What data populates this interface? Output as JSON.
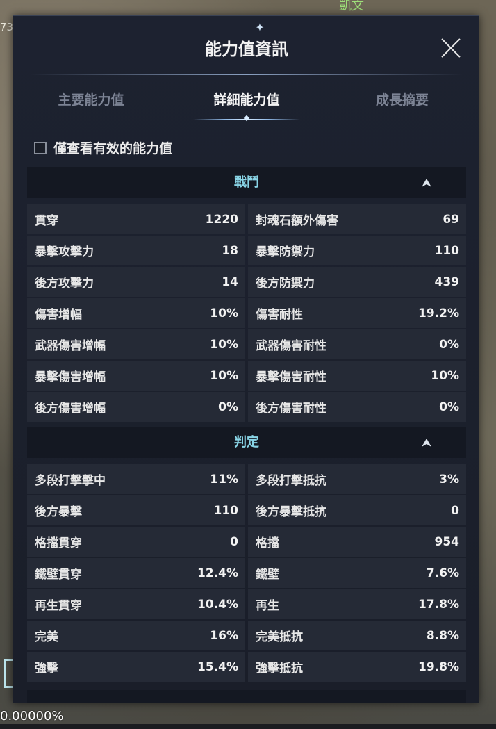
{
  "background": {
    "left_edge_text": "73",
    "top_text": "凱文",
    "bottom_text": "0.00000%"
  },
  "dialog": {
    "title": "能力值資訊",
    "close_icon": "close-icon",
    "tabs": [
      {
        "label": "主要能力值",
        "active": false
      },
      {
        "label": "詳細能力值",
        "active": true
      },
      {
        "label": "成長摘要",
        "active": false
      }
    ],
    "filter": {
      "label": "僅查看有效的能力值",
      "checked": false
    },
    "sections": [
      {
        "title": "戰鬥",
        "collapse_icon": "chevron-up-icon",
        "rows": [
          [
            {
              "label": "貫穿",
              "value": "1220"
            },
            {
              "label": "封魂石額外傷害",
              "value": "69"
            }
          ],
          [
            {
              "label": "暴擊攻擊力",
              "value": "18"
            },
            {
              "label": "暴擊防禦力",
              "value": "110"
            }
          ],
          [
            {
              "label": "後方攻擊力",
              "value": "14"
            },
            {
              "label": "後方防禦力",
              "value": "439"
            }
          ],
          [
            {
              "label": "傷害增幅",
              "value": "10%"
            },
            {
              "label": "傷害耐性",
              "value": "19.2%"
            }
          ],
          [
            {
              "label": "武器傷害增幅",
              "value": "10%"
            },
            {
              "label": "武器傷害耐性",
              "value": "0%"
            }
          ],
          [
            {
              "label": "暴擊傷害增幅",
              "value": "10%"
            },
            {
              "label": "暴擊傷害耐性",
              "value": "10%"
            }
          ],
          [
            {
              "label": "後方傷害增幅",
              "value": "0%"
            },
            {
              "label": "後方傷害耐性",
              "value": "0%"
            }
          ]
        ]
      },
      {
        "title": "判定",
        "collapse_icon": "chevron-up-icon",
        "rows": [
          [
            {
              "label": "多段打擊擊中",
              "value": "11%"
            },
            {
              "label": "多段打擊抵抗",
              "value": "3%"
            }
          ],
          [
            {
              "label": "後方暴擊",
              "value": "110"
            },
            {
              "label": "後方暴擊抵抗",
              "value": "0"
            }
          ],
          [
            {
              "label": "格擋貫穿",
              "value": "0"
            },
            {
              "label": "格擋",
              "value": "954"
            }
          ],
          [
            {
              "label": "鐵壁貫穿",
              "value": "12.4%"
            },
            {
              "label": "鐵壁",
              "value": "7.6%"
            }
          ],
          [
            {
              "label": "再生貫穿",
              "value": "10.4%"
            },
            {
              "label": "再生",
              "value": "17.8%"
            }
          ],
          [
            {
              "label": "完美",
              "value": "16%"
            },
            {
              "label": "完美抵抗",
              "value": "8.8%"
            }
          ],
          [
            {
              "label": "強擊",
              "value": "15.4%"
            },
            {
              "label": "強擊抵抗",
              "value": "19.8%"
            }
          ]
        ]
      }
    ]
  },
  "colors": {
    "panel_bg": "#1d2230",
    "section_title": "#89d4e6",
    "cell_bg": "#252a36",
    "tab_inactive": "#7c8394",
    "tab_active": "#f4f4f4"
  }
}
